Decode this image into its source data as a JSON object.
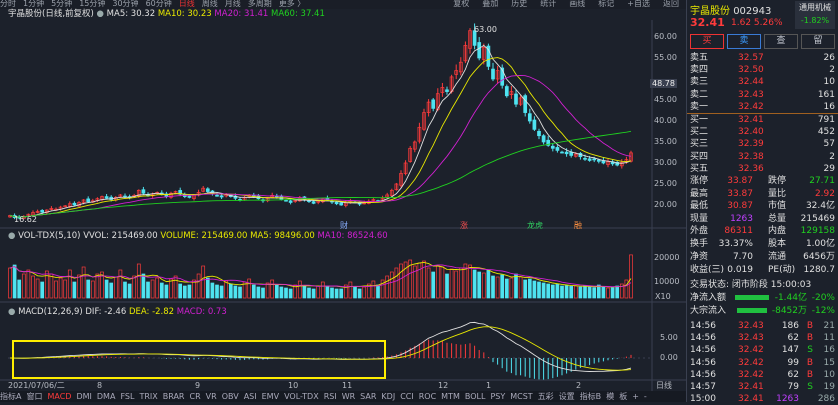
{
  "toolbar": {
    "periods": [
      "分时",
      "1分钟",
      "5分钟",
      "15分钟",
      "30分钟",
      "60分钟",
      "日线",
      "周线",
      "月线",
      "多周期",
      "更多 〉"
    ],
    "active": "日线",
    "tools": [
      "复权",
      "叠加",
      "历史",
      "统计",
      "画线",
      "标记",
      "+自选",
      "返回"
    ]
  },
  "header": {
    "title": "宇晶股份(日线,前复权)",
    "ma5": "MA5: 30.32",
    "ma10": "MA10: 30.23",
    "ma20": "MA20: 31.41",
    "ma60": "MA60: 37.41"
  },
  "price_axis": [
    "60.00",
    "55.00",
    "48.78",
    "45.00",
    "40.00",
    "35.00",
    "30.00",
    "25.00",
    "20.00"
  ],
  "annotations": {
    "high": "63.00",
    "low": "16.62",
    "events": [
      "财",
      "涨",
      "龙虎",
      "融"
    ]
  },
  "volume": {
    "title": "VOL-TDX(5,10)",
    "vvol": "VVOL: 215469.00",
    "volume": "VOLUME: 215469.00",
    "ma5": "MA5: 98496.00",
    "ma10": "MA10: 86524.60",
    "axis": [
      "20000",
      "10000",
      "X10"
    ]
  },
  "macd": {
    "title": "MACD(12,26,9)",
    "dif": "DIF: -2.46",
    "dea": "DEA: -2.82",
    "macd": "MACD: 0.73",
    "axis": [
      "5.00",
      "0.00"
    ]
  },
  "dates": [
    "2021/07/06/二",
    "8",
    "9",
    "10",
    "11",
    "12",
    "1",
    "2",
    "日线"
  ],
  "tabs": [
    "指标A",
    "窗口",
    "MACD",
    "DMI",
    "DMA",
    "FSL",
    "TRIX",
    "BRAR",
    "CR",
    "VR",
    "OBV",
    "ASI",
    "EMV",
    "VOL-TDX",
    "RSI",
    "WR",
    "SAR",
    "KDJ",
    "CCI",
    "ROC",
    "MTM",
    "BOLL",
    "PSY",
    "MCST",
    "五彩",
    "设置",
    "指标B",
    "模",
    "板",
    "+",
    "-"
  ],
  "active_tab": "MACD",
  "colors": {
    "up": "#ff3b3b",
    "down": "#4fe3f0",
    "ma5": "#e0e0e0",
    "ma10": "#e8e800",
    "ma20": "#d020d0",
    "ma60": "#20d020",
    "highlight": "#ffee00"
  },
  "chart_data": {
    "type": "candlestick",
    "closes": [
      17.5,
      17.0,
      16.9,
      17.3,
      17.8,
      18.2,
      18.5,
      18.3,
      18.8,
      19.2,
      19.0,
      19.5,
      19.8,
      20.3,
      20.0,
      20.6,
      21.2,
      20.8,
      21.0,
      21.5,
      22.0,
      21.6,
      21.3,
      21.8,
      22.4,
      22.0,
      21.7,
      22.3,
      23.5,
      22.8,
      22.2,
      22.6,
      23.0,
      22.5,
      22.1,
      22.8,
      23.2,
      22.6,
      22.0,
      21.8,
      22.4,
      23.0,
      24.0,
      23.2,
      22.6,
      22.2,
      21.9,
      22.5,
      22.0,
      21.6,
      21.2,
      21.8,
      22.4,
      22.0,
      21.5,
      21.0,
      21.6,
      22.3,
      22.0,
      21.4,
      21.0,
      20.6,
      21.1,
      21.8,
      21.3,
      20.8,
      20.4,
      20.9,
      21.5,
      21.2,
      20.7,
      20.3,
      20.0,
      20.5,
      21.0,
      20.6,
      20.2,
      20.5,
      20.9,
      21.3,
      21.0,
      21.6,
      22.4,
      23.5,
      25.0,
      27.5,
      30.0,
      33.5,
      35.0,
      38.5,
      42.0,
      44.5,
      43.0,
      46.5,
      48.0,
      47.0,
      50.5,
      52.0,
      54.0,
      58.0,
      61.5,
      58.0,
      55.0,
      57.5,
      53.0,
      50.0,
      52.0,
      48.5,
      46.0,
      47.0,
      44.0,
      45.5,
      42.0,
      40.0,
      38.0,
      36.5,
      35.0,
      34.2,
      33.5,
      33.0,
      32.6,
      32.2,
      31.8,
      32.1,
      31.5,
      31.0,
      30.6,
      30.9,
      30.4,
      30.0,
      30.3,
      29.8,
      29.5,
      30.1,
      30.8,
      32.41
    ],
    "volumes": [
      15000,
      16500,
      9000,
      12000,
      14000,
      11000,
      9500,
      8000,
      13500,
      12000,
      8500,
      10000,
      9000,
      14000,
      8000,
      11500,
      15500,
      9000,
      8500,
      12000,
      13000,
      9000,
      7500,
      10500,
      14000,
      8000,
      7000,
      11000,
      17000,
      12000,
      8000,
      9000,
      10000,
      7500,
      6500,
      9500,
      11000,
      7000,
      6000,
      6500,
      9000,
      12000,
      16000,
      10000,
      7500,
      6500,
      6000,
      8500,
      7000,
      6000,
      5500,
      8000,
      9500,
      6500,
      5500,
      5000,
      7500,
      9000,
      6500,
      5500,
      5000,
      4500,
      6500,
      8500,
      6000,
      5000,
      4500,
      6000,
      8000,
      6000,
      5000,
      4500,
      4500,
      6500,
      8000,
      5500,
      4500,
      5500,
      7000,
      8500,
      6500,
      9000,
      11000,
      13000,
      15000,
      17000,
      18000,
      19000,
      16000,
      17500,
      18500,
      15000,
      13000,
      16000,
      15500,
      12000,
      14500,
      13500,
      15000,
      17000,
      16500,
      14000,
      13000,
      12500,
      14000,
      11000,
      10500,
      11500,
      9500,
      10000,
      12000,
      10500,
      9000,
      9500,
      8500,
      8000,
      7500,
      7000,
      6500,
      6800,
      6000,
      6200,
      5800,
      6000,
      5500,
      6000,
      5500,
      5200,
      6500,
      5800,
      5000,
      5200,
      6000,
      7000,
      9000,
      21547
    ],
    "price_range": [
      15,
      64
    ],
    "volume_range": [
      0,
      22000
    ],
    "macd_range": [
      -6,
      11
    ]
  },
  "panel": {
    "name": "宇晶股份",
    "code": "002943",
    "industry": "通用机械",
    "industry_change": "-1.82%",
    "price": "32.41",
    "change": "1.62",
    "pct": "5.26%",
    "buttons": [
      "买",
      "卖",
      "查",
      "留"
    ],
    "asks": [
      [
        "卖五",
        "32.57",
        "26"
      ],
      [
        "卖四",
        "32.50",
        "2"
      ],
      [
        "卖三",
        "32.44",
        "10"
      ],
      [
        "卖二",
        "32.43",
        "161"
      ],
      [
        "卖一",
        "32.42",
        "16"
      ]
    ],
    "bids": [
      [
        "买一",
        "32.41",
        "791"
      ],
      [
        "买二",
        "32.40",
        "452"
      ],
      [
        "买三",
        "32.39",
        "57"
      ],
      [
        "买四",
        "32.38",
        "2"
      ],
      [
        "买五",
        "32.36",
        "29"
      ]
    ],
    "stats": [
      [
        "涨停",
        "33.87",
        "跌停",
        "27.71"
      ],
      [
        "最高",
        "33.87",
        "量比",
        "2.92"
      ],
      [
        "最低",
        "30.87",
        "市值",
        "32.4亿"
      ],
      [
        "现量",
        "1263",
        "总量",
        "215469"
      ],
      [
        "外盘",
        "86311",
        "内盘",
        "129158"
      ],
      [
        "换手",
        "33.37%",
        "股本",
        "1.00亿"
      ],
      [
        "净资",
        "7.70",
        "流通",
        "6456万"
      ],
      [
        "收益(三)",
        "0.019",
        "PE(动)",
        "1280.7"
      ]
    ],
    "status": "交易状态: 闭市阶段 15:00:03",
    "flows": [
      [
        "净流入额",
        "-1.44亿",
        "-20%"
      ],
      [
        "大宗流入",
        "-8452万",
        "-12%"
      ]
    ],
    "trades": [
      [
        "14:56",
        "32.43",
        "186",
        "B",
        "21"
      ],
      [
        "14:56",
        "32.43",
        "62",
        "B",
        "11"
      ],
      [
        "14:56",
        "32.42",
        "147",
        "S",
        "16"
      ],
      [
        "14:56",
        "32.42",
        "99",
        "B",
        "15"
      ],
      [
        "14:56",
        "32.42",
        "62",
        "B",
        "10"
      ],
      [
        "14:57",
        "32.41",
        "79",
        "S",
        "19"
      ],
      [
        "15:00",
        "32.41",
        "1263",
        "",
        "286"
      ]
    ]
  }
}
